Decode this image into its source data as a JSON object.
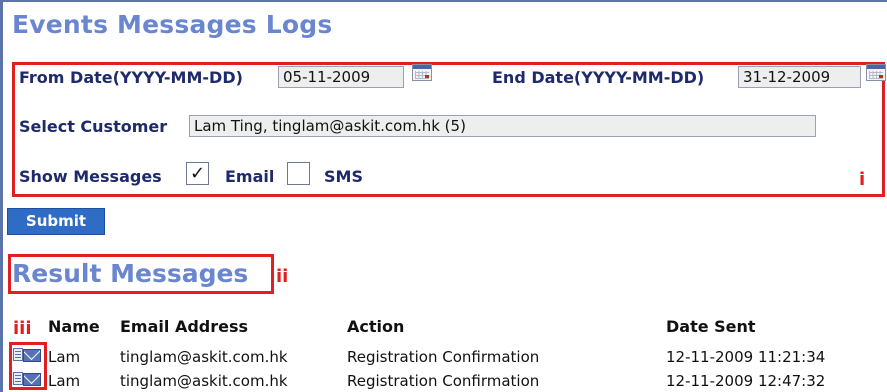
{
  "page": {
    "title": "Events Messages Logs"
  },
  "filters": {
    "from_date": {
      "label": "From Date(YYYY-MM-DD)",
      "value": "05-11-2009"
    },
    "end_date": {
      "label": "End Date(YYYY-MM-DD)",
      "value": "31-12-2009"
    },
    "customer": {
      "label": "Select Customer",
      "value": "Lam Ting, tinglam@askit.com.hk (5)"
    },
    "show_messages": {
      "label": "Show Messages",
      "email": {
        "label": "Email",
        "checked": true,
        "mark": "✓"
      },
      "sms": {
        "label": "SMS",
        "checked": false,
        "mark": ""
      }
    },
    "annotation": "i"
  },
  "submit": {
    "label": "Submit"
  },
  "results": {
    "title": "Result Messages",
    "annotation": "ii",
    "icon_annotation": "iii",
    "columns": [
      "Name",
      "Email Address",
      "Action",
      "Date Sent"
    ],
    "rows": [
      {
        "icon": "mail-icon",
        "name": "Lam",
        "email": "tinglam@askit.com.hk",
        "action": "Registration Confirmation",
        "date_sent": "12-11-2009 11:21:34"
      },
      {
        "icon": "mail-icon",
        "name": "Lam",
        "email": "tinglam@askit.com.hk",
        "action": "Registration Confirmation",
        "date_sent": "12-11-2009 12:47:32"
      }
    ]
  },
  "colors": {
    "title": "#6a86cf",
    "annotation_red": "#e02020",
    "submit_bg": "#2f6cc6"
  }
}
